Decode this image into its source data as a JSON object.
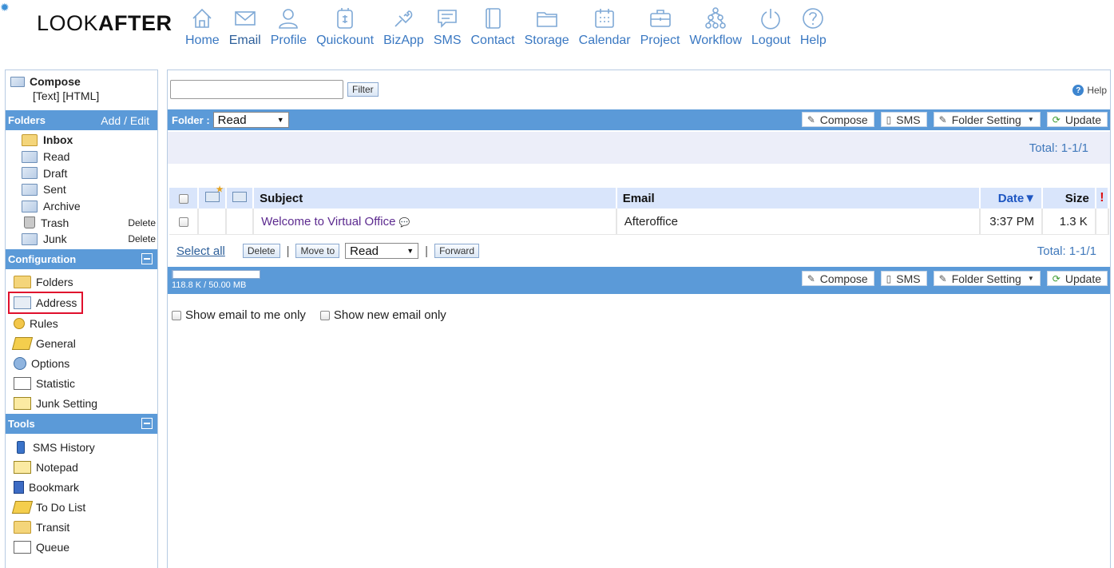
{
  "app": {
    "logo_light": "LOOK",
    "logo_bold": "AFTER"
  },
  "nav": [
    {
      "label": "Home",
      "icon": "home-icon"
    },
    {
      "label": "Email",
      "icon": "email-icon"
    },
    {
      "label": "Profile",
      "icon": "profile-icon"
    },
    {
      "label": "Quickount",
      "icon": "quickount-icon"
    },
    {
      "label": "BizApp",
      "icon": "bizapp-icon"
    },
    {
      "label": "SMS",
      "icon": "sms-icon"
    },
    {
      "label": "Contact",
      "icon": "contact-icon"
    },
    {
      "label": "Storage",
      "icon": "storage-icon"
    },
    {
      "label": "Calendar",
      "icon": "calendar-icon"
    },
    {
      "label": "Project",
      "icon": "project-icon"
    },
    {
      "label": "Workflow",
      "icon": "workflow-icon"
    },
    {
      "label": "Logout",
      "icon": "logout-icon"
    },
    {
      "label": "Help",
      "icon": "help-icon"
    }
  ],
  "sidebar": {
    "compose_title": "Compose",
    "compose_text": "[Text]",
    "compose_html": "[HTML]",
    "folders_header": "Folders",
    "folders_add_edit": "Add / Edit",
    "folders": [
      {
        "label": "Inbox",
        "bold": true,
        "delete": ""
      },
      {
        "label": "Read",
        "delete": ""
      },
      {
        "label": "Draft",
        "delete": ""
      },
      {
        "label": "Sent",
        "delete": ""
      },
      {
        "label": "Archive",
        "delete": ""
      },
      {
        "label": "Trash",
        "delete": "Delete"
      },
      {
        "label": "Junk",
        "delete": "Delete"
      }
    ],
    "config_header": "Configuration",
    "config_items": [
      "Folders",
      "Address",
      "Rules",
      "General",
      "Options",
      "Statistic",
      "Junk Setting"
    ],
    "tools_header": "Tools",
    "tools_items": [
      "SMS History",
      "Notepad",
      "Bookmark",
      "To Do List",
      "Transit",
      "Queue"
    ]
  },
  "main": {
    "filter_placeholder": "",
    "filter_button": "Filter",
    "help_label": "Help",
    "folder_label": "Folder :",
    "folder_selected": "Read",
    "buttons": {
      "compose": "Compose",
      "sms": "SMS",
      "folder_setting": "Folder Setting",
      "update": "Update"
    },
    "total_text": "Total: 1-1/1",
    "columns": {
      "subject": "Subject",
      "email": "Email",
      "date": "Date",
      "size": "Size"
    },
    "rows": [
      {
        "subject": "Welcome to Virtual Office",
        "email": "Afteroffice",
        "date": "3:37 PM",
        "size": "1.3 K"
      }
    ],
    "select_all": "Select all",
    "delete_button": "Delete",
    "move_to_button": "Move to",
    "move_target": "Read",
    "forward_button": "Forward",
    "quota_text": "118.8 K / 50.00 MB",
    "quota_used_fraction": 0.0023,
    "show_to_me_only": "Show email to me only",
    "show_new_only": "Show new email only"
  }
}
